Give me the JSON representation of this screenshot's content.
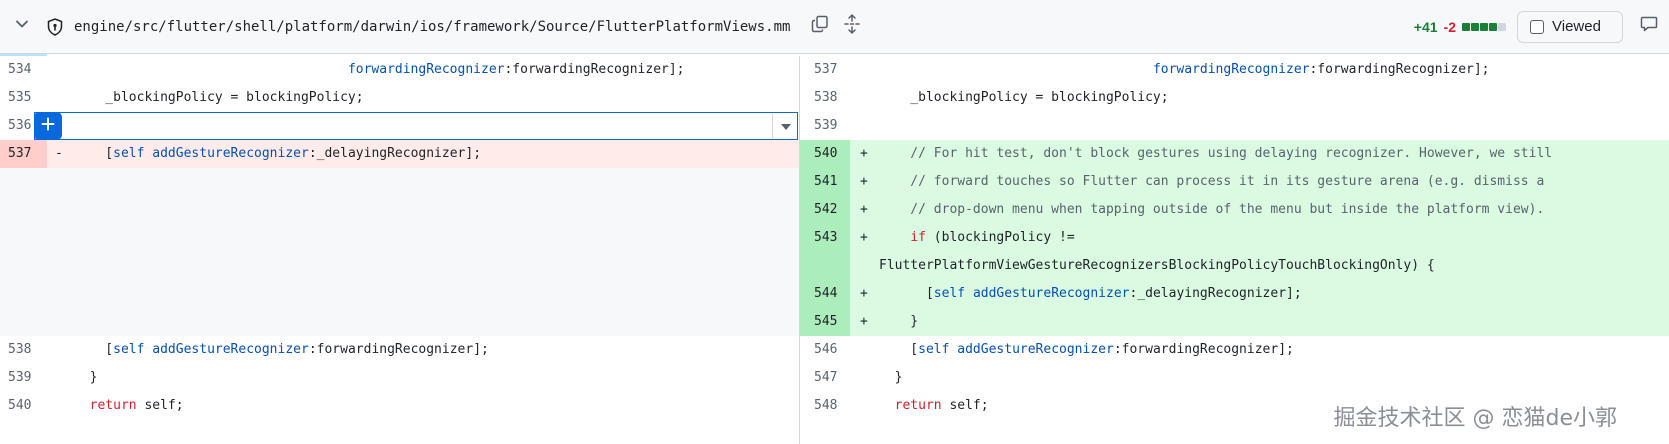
{
  "file_header": {
    "file_path": "engine/src/flutter/shell/platform/darwin/ios/framework/Source/FlutterPlatformViews.mm",
    "additions": "+41",
    "deletions": "-2",
    "viewed_label": "Viewed",
    "icons": [
      "chevron-down-icon",
      "shield-icon",
      "copy-icon",
      "expand-icon",
      "comment-icon"
    ]
  },
  "left_rows": [
    {
      "num": "534",
      "sign": "",
      "parts": [
        {
          "t": "                                   "
        },
        {
          "t": "forwardingRecognizer",
          "c": "fn"
        },
        {
          "t": ":forwardingRecognizer];"
        }
      ]
    },
    {
      "num": "535",
      "sign": "",
      "parts": [
        {
          "t": "    _blockingPolicy = blockingPolicy;"
        }
      ]
    },
    {
      "num": "536",
      "sign": "",
      "parts": []
    },
    {
      "num": "537",
      "sign": "-",
      "parts": [
        {
          "t": "    ["
        },
        {
          "t": "self",
          "c": "fn"
        },
        {
          "t": " "
        },
        {
          "t": "addGestureRecognizer",
          "c": "fn"
        },
        {
          "t": ":_delayingRecognizer];"
        }
      ]
    },
    {
      "num": "538",
      "sign": "",
      "parts": [
        {
          "t": "    ["
        },
        {
          "t": "self",
          "c": "fn"
        },
        {
          "t": " "
        },
        {
          "t": "addGestureRecognizer",
          "c": "fn"
        },
        {
          "t": ":forwardingRecognizer];"
        }
      ]
    },
    {
      "num": "539",
      "sign": "",
      "parts": [
        {
          "t": "  }"
        }
      ]
    },
    {
      "num": "540",
      "sign": "",
      "parts": [
        {
          "t": "  "
        },
        {
          "t": "return",
          "c": "kw"
        },
        {
          "t": " self;"
        }
      ]
    }
  ],
  "right_rows": [
    {
      "num": "537",
      "sign": "",
      "parts": [
        {
          "t": "                                   "
        },
        {
          "t": "forwardingRecognizer",
          "c": "fn"
        },
        {
          "t": ":forwardingRecognizer];"
        }
      ]
    },
    {
      "num": "538",
      "sign": "",
      "parts": [
        {
          "t": "    _blockingPolicy = blockingPolicy;"
        }
      ]
    },
    {
      "num": "539",
      "sign": "",
      "parts": []
    },
    {
      "num": "540",
      "sign": "+",
      "parts": [
        {
          "t": "    // For hit test, don't block gestures using delaying recognizer. However, we still",
          "c": "cm"
        }
      ]
    },
    {
      "num": "541",
      "sign": "+",
      "parts": [
        {
          "t": "    // forward touches so Flutter can process it in its gesture arena (e.g. dismiss a",
          "c": "cm"
        }
      ]
    },
    {
      "num": "542",
      "sign": "+",
      "parts": [
        {
          "t": "    // drop-down menu when tapping outside of the menu but inside the platform view).",
          "c": "cm"
        }
      ]
    },
    {
      "num": "543",
      "sign": "+",
      "parts": [
        {
          "t": "    "
        },
        {
          "t": "if",
          "c": "kw"
        },
        {
          "t": " (blockingPolicy !="
        }
      ]
    },
    {
      "num": "",
      "sign": "",
      "parts": [
        {
          "t": "FlutterPlatformViewGestureRecognizersBlockingPolicyTouchBlockingOnly) {"
        }
      ]
    },
    {
      "num": "544",
      "sign": "+",
      "parts": [
        {
          "t": "      ["
        },
        {
          "t": "self",
          "c": "fn"
        },
        {
          "t": " "
        },
        {
          "t": "addGestureRecognizer",
          "c": "fn"
        },
        {
          "t": ":_delayingRecognizer];"
        }
      ]
    },
    {
      "num": "545",
      "sign": "+",
      "parts": [
        {
          "t": "    }"
        }
      ]
    },
    {
      "num": "546",
      "sign": "",
      "parts": [
        {
          "t": "    ["
        },
        {
          "t": "self",
          "c": "fn"
        },
        {
          "t": " "
        },
        {
          "t": "addGestureRecognizer",
          "c": "fn"
        },
        {
          "t": ":forwardingRecognizer];"
        }
      ]
    },
    {
      "num": "547",
      "sign": "",
      "parts": [
        {
          "t": "  }"
        }
      ]
    },
    {
      "num": "548",
      "sign": "",
      "parts": [
        {
          "t": "  "
        },
        {
          "t": "return",
          "c": "kw"
        },
        {
          "t": " self;"
        }
      ]
    }
  ],
  "watermark": "掘金技术社区 @ 恋猫de小郭",
  "colors": {
    "added_bg": "#dafbe1",
    "added_num_bg": "#aceebb",
    "deleted_bg": "#ffebe9",
    "deleted_num_bg": "#ffcecb",
    "accent": "#0969da",
    "keyword": "#cf222e",
    "function": "#0550ae",
    "comment": "#59636e"
  }
}
